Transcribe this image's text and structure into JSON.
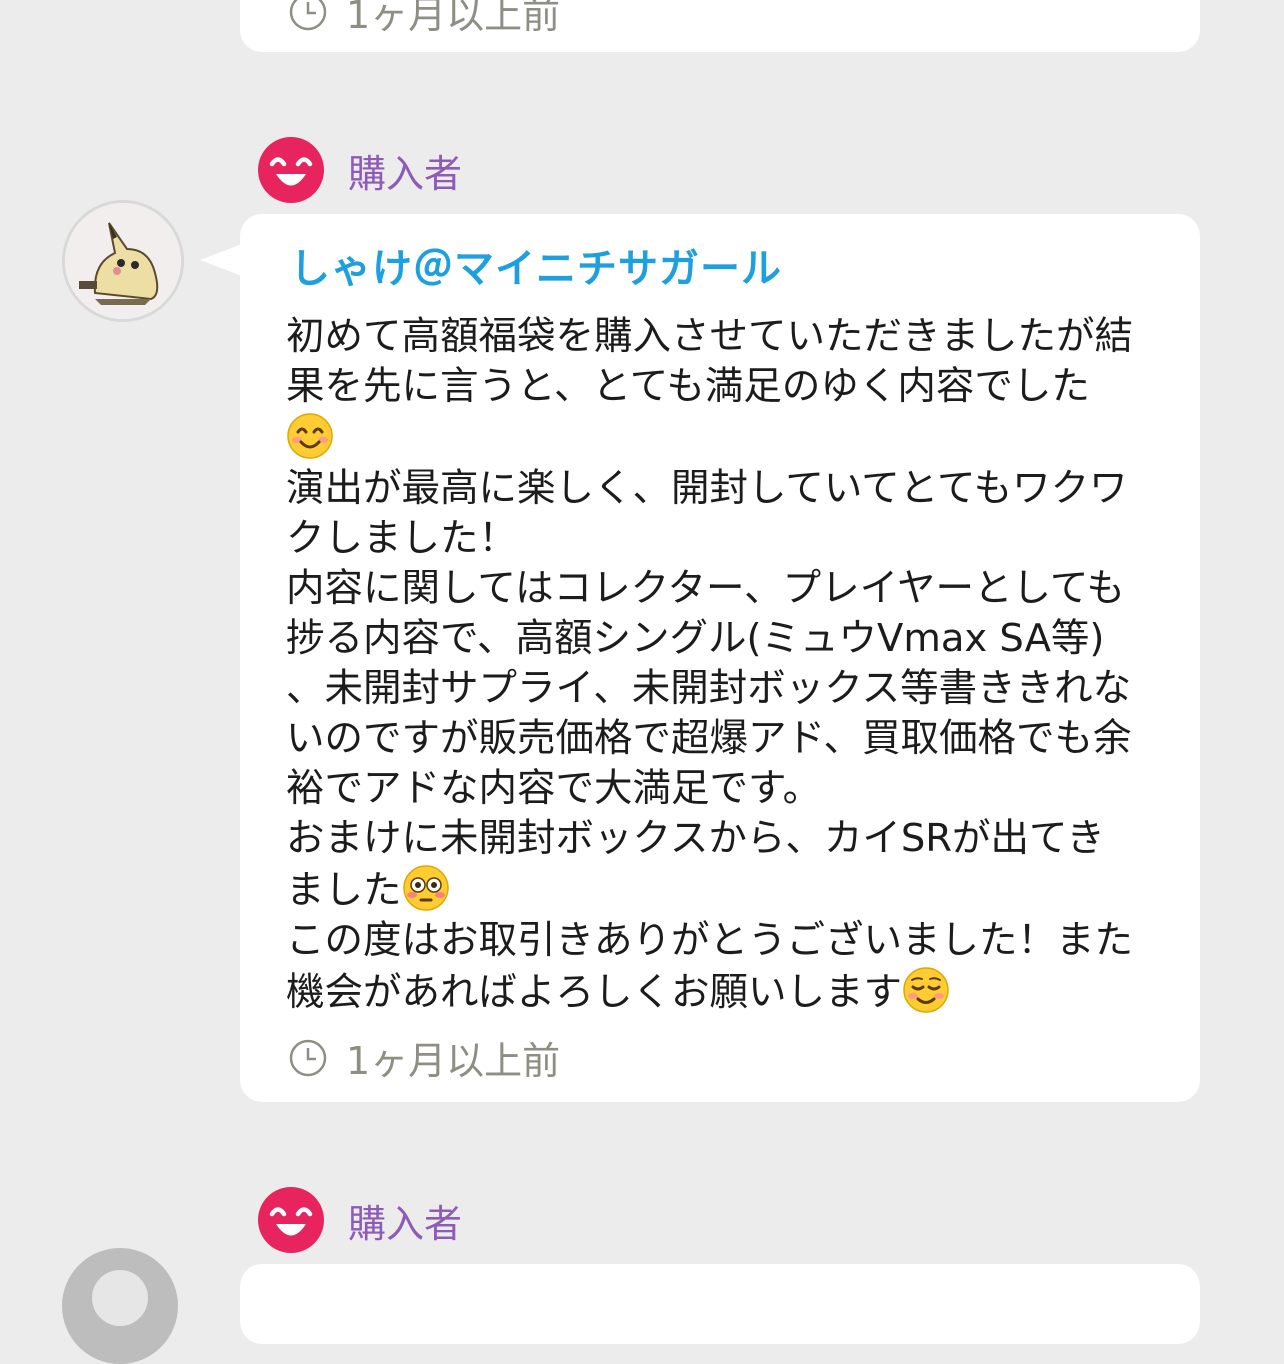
{
  "review_above": {
    "timestamp": "1ヶ月以上前"
  },
  "review": {
    "role_label": "購入者",
    "reviewer_name": "しゃけ＠マイニチサガール",
    "lines": [
      "初めて高額福袋を購入させていただきましたが結",
      "果を先に言うと、とても満足のゆく内容でした",
      "演出が最高に楽しく、開封していてとてもワクワ",
      "クしました！",
      "内容に関してはコレクター、プレイヤーとしても",
      "捗る内容で、高額シングル(ミュウVmax SA等)",
      "、未開封サプライ、未開封ボックス等書ききれな",
      "いのですが販売価格で超爆アド、買取価格でも余",
      "裕でアドな内容で大満足です。",
      "おまけに未開封ボックスから、カイSRが出てき",
      "ました",
      "この度はお取引きありがとうございました！また",
      "機会があればよろしくお願いします"
    ],
    "emojis": [
      "smiling-face-emoji",
      "flushed-face-emoji",
      "relieved-smile-emoji"
    ],
    "timestamp": "1ヶ月以上前"
  },
  "review_below": {
    "role_label": "購入者"
  },
  "colors": {
    "background": "#ececec",
    "card": "#ffffff",
    "reviewer_name": "#1e9fe0",
    "role_label": "#8e5bb6",
    "badge_icon": "#e8245e",
    "timestamp": "#8e8e84"
  }
}
